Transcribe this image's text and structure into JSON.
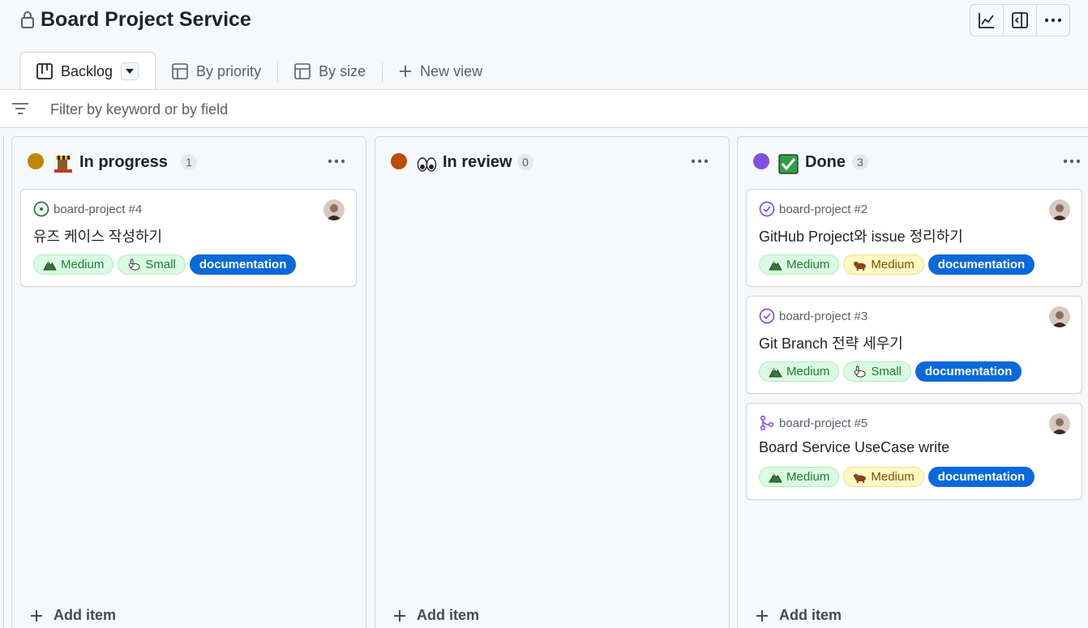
{
  "header": {
    "title": "Board Project Service",
    "tools": [
      "insights-icon",
      "panel-icon",
      "more-icon"
    ]
  },
  "tabs": [
    {
      "label": "Backlog",
      "icon": "board-icon",
      "active": true
    },
    {
      "label": "By priority",
      "icon": "table-icon",
      "active": false
    },
    {
      "label": "By size",
      "icon": "table-icon",
      "active": false
    },
    {
      "label": "New view",
      "icon": "plus-icon",
      "active": false
    }
  ],
  "filter": {
    "placeholder": "Filter by keyword or by field"
  },
  "columns": [
    {
      "title": "In progress",
      "count": "1",
      "dot_color": "#bf8700",
      "emoji": "construction-icon",
      "add_label": "Add item",
      "cards": [
        {
          "ref": "board-project #4",
          "status": "open-issue-icon",
          "title": "유즈 케이스 작성하기",
          "labels": [
            {
              "text": "Medium",
              "style": "green",
              "icon": "mountain-icon"
            },
            {
              "text": "Small",
              "style": "green",
              "icon": "rabbit-icon"
            },
            {
              "text": "documentation",
              "style": "doc"
            }
          ]
        }
      ]
    },
    {
      "title": "In review",
      "count": "0",
      "dot_color": "#bc4c00",
      "emoji": "eyes-icon",
      "add_label": "Add item",
      "cards": []
    },
    {
      "title": "Done",
      "count": "3",
      "dot_color": "#8250df",
      "emoji": "check-box-icon",
      "add_label": "Add item",
      "cards": [
        {
          "ref": "board-project #2",
          "status": "closed-issue-icon",
          "title": "GitHub Project와 issue 정리하기",
          "labels": [
            {
              "text": "Medium",
              "style": "green",
              "icon": "mountain-icon"
            },
            {
              "text": "Medium",
              "style": "yellow",
              "icon": "bear-icon"
            },
            {
              "text": "documentation",
              "style": "doc"
            }
          ]
        },
        {
          "ref": "board-project #3",
          "status": "closed-issue-icon",
          "title": "Git Branch 전략 세우기",
          "labels": [
            {
              "text": "Medium",
              "style": "green",
              "icon": "mountain-icon"
            },
            {
              "text": "Small",
              "style": "green",
              "icon": "rabbit-icon"
            },
            {
              "text": "documentation",
              "style": "doc"
            }
          ]
        },
        {
          "ref": "board-project #5",
          "status": "merged-pr-icon",
          "title": "Board Service UseCase write",
          "labels": [
            {
              "text": "Medium",
              "style": "green",
              "icon": "mountain-icon"
            },
            {
              "text": "Medium",
              "style": "yellow",
              "icon": "bear-icon"
            },
            {
              "text": "documentation",
              "style": "doc"
            }
          ]
        }
      ]
    }
  ]
}
